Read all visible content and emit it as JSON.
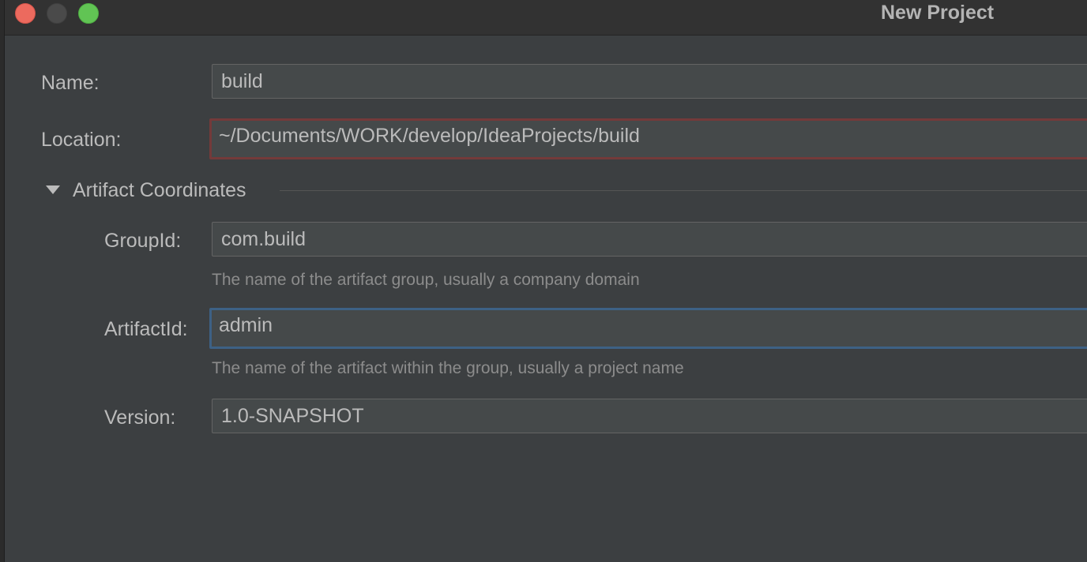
{
  "window": {
    "title": "New Project"
  },
  "form": {
    "name_label": "Name:",
    "name_value": "build",
    "location_label": "Location:",
    "location_value": "~/Documents/WORK/develop/IdeaProjects/build",
    "section_title": "Artifact Coordinates",
    "groupid_label": "GroupId:",
    "groupid_value": "com.build",
    "groupid_hint": "The name of the artifact group, usually a company domain",
    "artifactid_label": "ArtifactId:",
    "artifactid_value": "admin",
    "artifactid_hint": "The name of the artifact within the group, usually a project name",
    "version_label": "Version:",
    "version_value": "1.0-SNAPSHOT"
  },
  "colors": {
    "background": "#3c3f41",
    "titlebar": "#323232",
    "field_background": "#45494a",
    "error_border": "#743a3a",
    "focus_border": "#3d6185",
    "close_button": "#ec6a5e",
    "maximize_button": "#61c454"
  },
  "icons": {
    "section_toggle": "triangle-down-icon"
  }
}
